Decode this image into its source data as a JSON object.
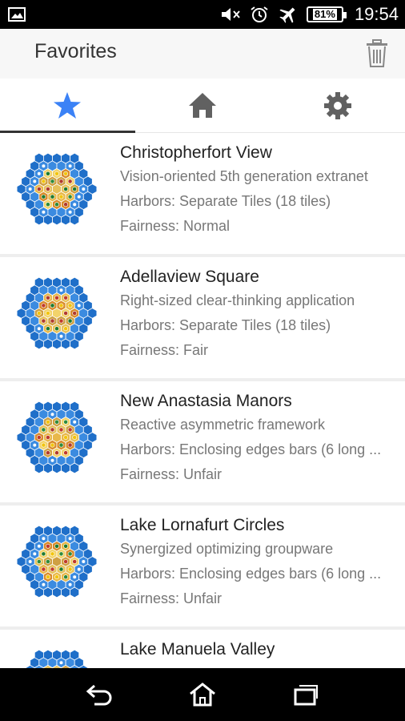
{
  "status_bar": {
    "battery": "81%",
    "time": "19:54"
  },
  "app_bar": {
    "title": "Favorites"
  },
  "tabs": [
    {
      "icon": "star-icon",
      "active": true
    },
    {
      "icon": "home-icon",
      "active": false
    },
    {
      "icon": "gear-icon",
      "active": false
    }
  ],
  "colors": {
    "accent": "#3b82f6",
    "tab_icon_inactive": "#616161"
  },
  "boards": [
    {
      "name": "Christopherfort View",
      "description": "Vision-oriented 5th generation extranet",
      "harbors": "Harbors: Separate Tiles (18 tiles)",
      "fairness": "Fairness: Normal"
    },
    {
      "name": "Adellaview Square",
      "description": "Right-sized clear-thinking application",
      "harbors": "Harbors: Separate Tiles (18 tiles)",
      "fairness": "Fairness: Fair"
    },
    {
      "name": "New Anastasia Manors",
      "description": "Reactive asymmetric framework",
      "harbors": "Harbors: Enclosing edges bars (6 long ...",
      "fairness": "Fairness: Unfair"
    },
    {
      "name": "Lake Lornafurt Circles",
      "description": "Synergized optimizing groupware",
      "harbors": "Harbors: Enclosing edges bars (6 long ...",
      "fairness": "Fairness: Unfair"
    },
    {
      "name": "Lake Manuela Valley",
      "description": "",
      "harbors": "",
      "fairness": ""
    }
  ]
}
